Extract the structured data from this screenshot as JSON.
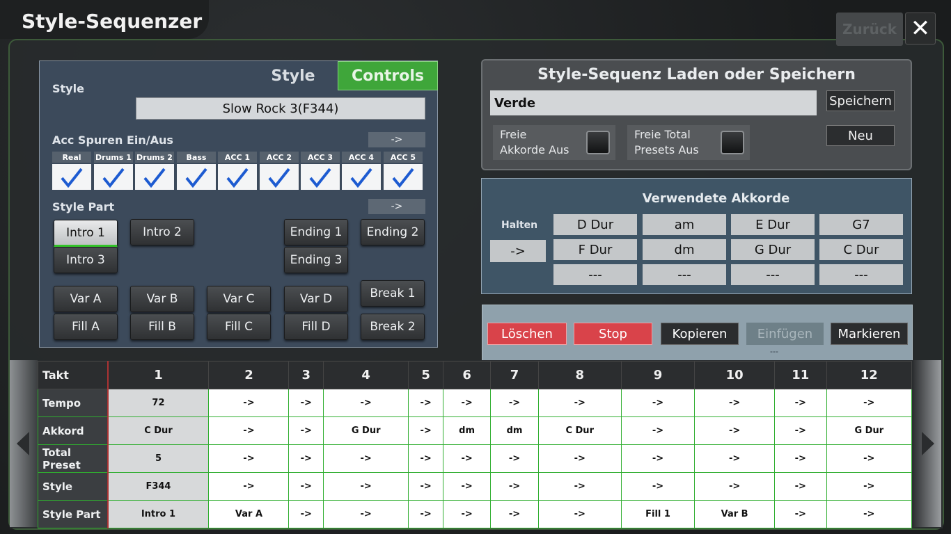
{
  "app": {
    "title": "Style-Sequenzer",
    "back_label": "Zurück",
    "close_label": "✕"
  },
  "left": {
    "tabs": {
      "style": "Style",
      "controls": "Controls"
    },
    "style_label": "Style",
    "style_value": "Slow Rock 3(F344)",
    "acc_label": "Acc Spuren Ein/Aus",
    "acc_arrow": "->",
    "tracks": [
      "Real",
      "Drums 1",
      "Drums 2",
      "Bass",
      "ACC 1",
      "ACC 2",
      "ACC 3",
      "ACC 4",
      "ACC 5"
    ],
    "part_label": "Style Part",
    "part_arrow": "->",
    "parts": {
      "intro1": "Intro 1",
      "intro2": "Intro 2",
      "intro3": "Intro 3",
      "ending1": "Ending 1",
      "ending2": "Ending 2",
      "ending3": "Ending 3",
      "varA": "Var A",
      "varB": "Var B",
      "varC": "Var C",
      "varD": "Var D",
      "fillA": "Fill A",
      "fillB": "Fill B",
      "fillC": "Fill C",
      "fillD": "Fill D",
      "break1": "Break 1",
      "break2": "Break 2"
    }
  },
  "sequence": {
    "title": "Style-Sequenz Laden oder Speichern",
    "name": "Verde",
    "save_label": "Speichern",
    "new_label": "Neu",
    "toggle1": [
      "Freie",
      "Akkorde Aus"
    ],
    "toggle2": [
      "Freie Total",
      "Presets Aus"
    ]
  },
  "chords": {
    "title": "Verwendete Akkorde",
    "hold_label": "Halten",
    "hold_btn": "->",
    "items": [
      "D Dur",
      "am",
      "E Dur",
      "G7",
      "F Dur",
      "dm",
      "G Dur",
      "C Dur",
      "---",
      "---",
      "---",
      "---"
    ]
  },
  "actions": {
    "delete": "Löschen",
    "stop": "Stop",
    "copy": "Kopieren",
    "paste": "Einfügen",
    "mark": "Markieren",
    "sub": "---",
    "colors": {
      "red": "#d9434a",
      "dark": "#2b2d2f",
      "disabled": "#6e8088"
    }
  },
  "table": {
    "header": "Takt",
    "columns": [
      "1",
      "2",
      "3",
      "4",
      "5",
      "6",
      "7",
      "8",
      "9",
      "10",
      "11",
      "12"
    ],
    "rows": [
      {
        "label": "Tempo",
        "cells": [
          "72",
          "->",
          "->",
          "->",
          "->",
          "->",
          "->",
          "->",
          "->",
          "->",
          "->",
          "->"
        ]
      },
      {
        "label": "Akkord",
        "cells": [
          "C Dur",
          "->",
          "->",
          "G Dur",
          "->",
          "dm",
          "dm",
          "C Dur",
          "->",
          "->",
          "->",
          "G Dur"
        ]
      },
      {
        "label": "Total Preset",
        "cells": [
          "5",
          "->",
          "->",
          "->",
          "->",
          "->",
          "->",
          "->",
          "->",
          "->",
          "->",
          "->"
        ]
      },
      {
        "label": "Style",
        "cells": [
          "F344",
          "->",
          "->",
          "->",
          "->",
          "->",
          "->",
          "->",
          "->",
          "->",
          "->",
          "->"
        ]
      },
      {
        "label": "Style Part",
        "cells": [
          "Intro 1",
          "Var A",
          "->",
          "->",
          "->",
          "->",
          "->",
          "->",
          "Fill 1",
          "Var B",
          "->",
          "->"
        ]
      }
    ]
  }
}
